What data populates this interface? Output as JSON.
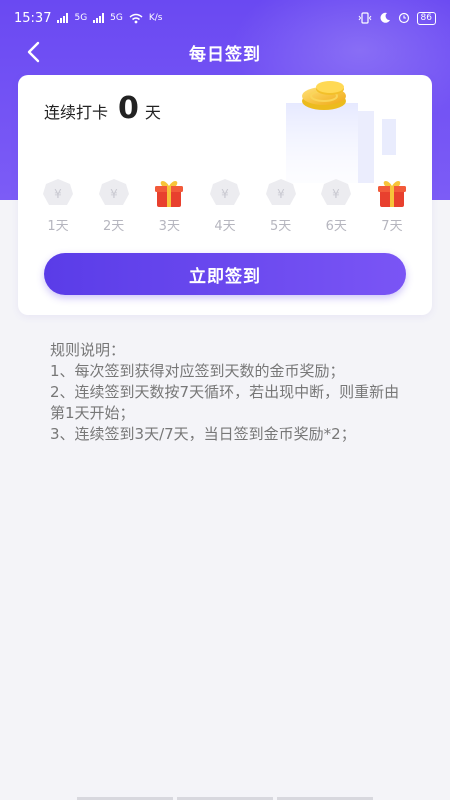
{
  "status_bar": {
    "time": "15:37",
    "sig1": "5G",
    "sig2": "5G",
    "net_speed": "K/s",
    "battery": "86"
  },
  "nav": {
    "title": "每日签到"
  },
  "card": {
    "streak_label": "连续打卡",
    "streak_count": "0",
    "streak_unit": "天",
    "days": [
      {
        "label": "1天",
        "type": "coin"
      },
      {
        "label": "2天",
        "type": "coin"
      },
      {
        "label": "3天",
        "type": "gift"
      },
      {
        "label": "4天",
        "type": "coin"
      },
      {
        "label": "5天",
        "type": "coin"
      },
      {
        "label": "6天",
        "type": "coin"
      },
      {
        "label": "7天",
        "type": "gift"
      }
    ],
    "checkin_button": "立即签到"
  },
  "rules": {
    "title": "规则说明：",
    "items": [
      "1、每次签到获得对应签到天数的金币奖励；",
      "2、连续签到天数按7天循环，若出现中断，则重新由第1天开始；",
      "3、连续签到3天/7天，当日签到金币奖励*2；"
    ]
  },
  "colors": {
    "accent": "#6a49f2",
    "gold": "#f5c233",
    "gift_red": "#e8402e"
  }
}
